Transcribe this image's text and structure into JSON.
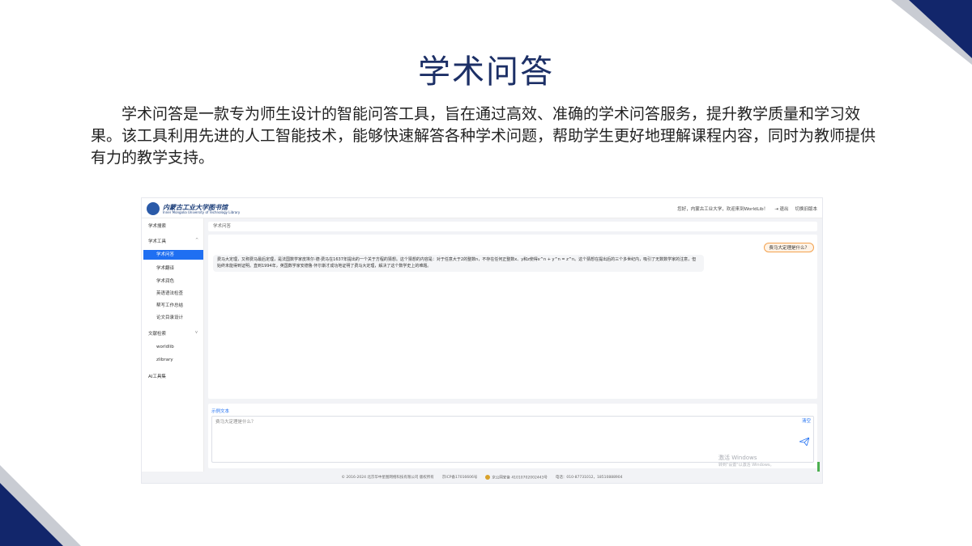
{
  "slide": {
    "title": "学术问答",
    "paragraph": "学术问答是一款专为师生设计的智能问答工具，旨在通过高效、准确的学术问答服务，提升教学质量和学习效果。该工具利用先进的人工智能技术，能够快速解答各种学术问题，帮助学生更好地理解课程内容，同时为教师提供有力的教学支持。",
    "colors": {
      "navy": "#12266b",
      "gray": "#c9ccd3",
      "title": "#1c2f66"
    }
  },
  "app": {
    "logo_text": "内蒙古工业大学图书馆",
    "logo_sub": "Inner Mongolia University of Technology Library",
    "header": {
      "greeting": "您好，内蒙古工业大学，欢迎来到WorldLib！",
      "logout": "退出",
      "switch_version": "切换旧版本"
    },
    "sidebar": {
      "items": [
        {
          "label": "学术搜索",
          "active": false
        },
        {
          "label": "学术工具",
          "active": false,
          "expanded": true
        },
        {
          "label": "学术问答",
          "active": true
        },
        {
          "label": "学术翻译",
          "active": false
        },
        {
          "label": "学术润色",
          "active": false
        },
        {
          "label": "英语语法检查",
          "active": false
        },
        {
          "label": "帮写工作总结",
          "active": false
        },
        {
          "label": "论文目录设计",
          "active": false
        },
        {
          "label": "文献检索",
          "active": false,
          "expanded": true
        },
        {
          "label": "worldlib",
          "active": false
        },
        {
          "label": "zlibrary",
          "active": false
        },
        {
          "label": "AI工具集",
          "active": false
        }
      ]
    },
    "panel_title": "学术问答",
    "chat": {
      "user_question": "费马大定理是什么？",
      "bot_answer": "费马大定理，又称费马最后定理，是法国数学家皮埃尔·德·费马在1637年提出的一个关于方程的猜想。这个猜想的内容是：对于任意大于2的整数n，不存在任何正整数x、y和z使得x^n + y^n = z^n。这个猜想在提出后的三个多世纪内，吸引了无数数学家的注意，但始终未能得到证明。直到1994年，英国数学家安德鲁·怀尔斯才成功地证明了费马大定理，解决了这个数学史上的难题。"
    },
    "input": {
      "example_label": "示例文本",
      "value": "费马大定理是什么？",
      "clear": "清空"
    },
    "watermark": {
      "title": "激活 Windows",
      "sub": "转到\"设置\"以激活 Windows。"
    },
    "footer": {
      "copyright": "© 2016-2024 北京华中星图网络科技有限公司 版权所有",
      "icp": "京ICP备17016606号",
      "police": "京公网安备 41010702002443号",
      "phone": "电话：010-87731012，18510888904"
    }
  }
}
